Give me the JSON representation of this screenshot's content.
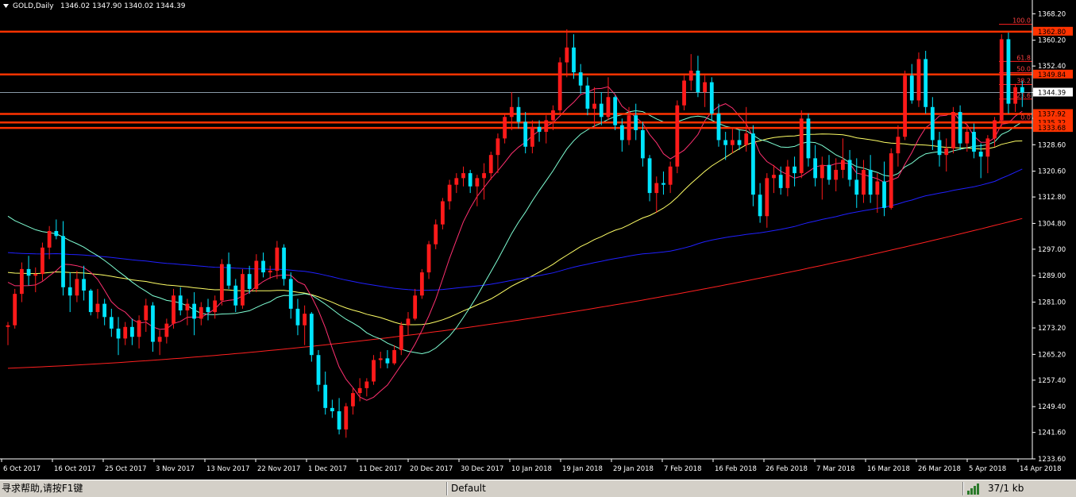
{
  "header": {
    "symbol": "GOLD,Daily",
    "ohlc": "1346.02 1347.90 1340.02 1344.39"
  },
  "chart_data": {
    "type": "candlestick",
    "symbol": "GOLD",
    "timeframe": "Daily",
    "ylim": [
      1233.6,
      1369.0
    ],
    "y_ticks": [
      "1368.20",
      "1360.20",
      "1352.40",
      "1344.39",
      "1336.60",
      "1328.60",
      "1320.60",
      "1312.80",
      "1304.80",
      "1297.00",
      "1289.00",
      "1281.00",
      "1273.20",
      "1265.20",
      "1257.40",
      "1249.40",
      "1241.60",
      "1233.60"
    ],
    "x_ticks": [
      "6 Oct 2017",
      "16 Oct 2017",
      "25 Oct 2017",
      "3 Nov 2017",
      "13 Nov 2017",
      "22 Nov 2017",
      "1 Dec 2017",
      "11 Dec 2017",
      "20 Dec 2017",
      "30 Dec 2017",
      "10 Jan 2018",
      "19 Jan 2018",
      "29 Jan 2018",
      "7 Feb 2018",
      "16 Feb 2018",
      "26 Feb 2018",
      "7 Mar 2018",
      "16 Mar 2018",
      "26 Mar 2018",
      "5 Apr 2018",
      "14 Apr 2018"
    ],
    "current_price": 1344.39,
    "horizontal_levels": [
      {
        "value": 1362.8,
        "label": "1362.80"
      },
      {
        "value": 1349.84,
        "label": "1349.84"
      },
      {
        "value": 1337.92,
        "label": "1337.92"
      },
      {
        "value": 1335.32,
        "label": "1335.32"
      },
      {
        "value": 1333.68,
        "label": "1333.68"
      }
    ],
    "fibonacci": [
      {
        "label": "100.0",
        "value": 1365.0
      },
      {
        "label": "61.8",
        "value": 1353.8
      },
      {
        "label": "50.0",
        "value": 1350.4
      },
      {
        "label": "38.2",
        "value": 1346.8
      },
      {
        "label": "23.6",
        "value": 1342.4
      },
      {
        "label": "0.0",
        "value": 1335.8
      }
    ],
    "candles": [
      [
        1273.5,
        1275.0,
        1268.0,
        1274.0
      ],
      [
        1274.0,
        1285.0,
        1273.0,
        1283.5
      ],
      [
        1283.5,
        1293.0,
        1281.0,
        1291.0
      ],
      [
        1291.0,
        1295.0,
        1286.0,
        1289.0
      ],
      [
        1289.0,
        1291.5,
        1284.0,
        1289.5
      ],
      [
        1289.5,
        1299.0,
        1287.5,
        1297.5
      ],
      [
        1297.5,
        1304.0,
        1294.0,
        1302.5
      ],
      [
        1302.5,
        1306.0,
        1300.0,
        1301.0
      ],
      [
        1301.0,
        1305.5,
        1283.0,
        1285.5
      ],
      [
        1285.5,
        1290.0,
        1278.0,
        1283.0
      ],
      [
        1283.0,
        1290.5,
        1281.0,
        1288.0
      ],
      [
        1288.0,
        1292.0,
        1281.5,
        1284.5
      ],
      [
        1284.5,
        1285.0,
        1277.0,
        1278.0
      ],
      [
        1278.0,
        1285.0,
        1276.0,
        1280.5
      ],
      [
        1280.5,
        1282.0,
        1274.0,
        1276.5
      ],
      [
        1276.5,
        1279.0,
        1270.5,
        1273.0
      ],
      [
        1273.0,
        1276.5,
        1265.0,
        1270.0
      ],
      [
        1270.0,
        1275.0,
        1268.0,
        1273.5
      ],
      [
        1273.5,
        1276.0,
        1268.0,
        1270.5
      ],
      [
        1270.5,
        1277.0,
        1267.0,
        1275.5
      ],
      [
        1275.5,
        1282.0,
        1272.0,
        1280.0
      ],
      [
        1280.0,
        1281.0,
        1266.0,
        1269.0
      ],
      [
        1269.0,
        1272.5,
        1265.0,
        1270.5
      ],
      [
        1270.5,
        1276.0,
        1268.5,
        1274.5
      ],
      [
        1274.5,
        1285.0,
        1273.0,
        1283.0
      ],
      [
        1283.0,
        1285.5,
        1277.0,
        1278.5
      ],
      [
        1278.5,
        1282.0,
        1274.0,
        1280.5
      ],
      [
        1280.5,
        1284.0,
        1271.0,
        1276.0
      ],
      [
        1276.0,
        1281.0,
        1274.0,
        1279.5
      ],
      [
        1279.5,
        1282.0,
        1275.5,
        1278.0
      ],
      [
        1278.0,
        1283.0,
        1276.0,
        1281.5
      ],
      [
        1281.5,
        1294.0,
        1280.0,
        1292.5
      ],
      [
        1292.5,
        1296.0,
        1285.0,
        1286.0
      ],
      [
        1286.0,
        1288.0,
        1278.0,
        1280.0
      ],
      [
        1280.0,
        1291.0,
        1279.0,
        1289.5
      ],
      [
        1289.5,
        1292.0,
        1283.5,
        1285.0
      ],
      [
        1285.0,
        1295.5,
        1284.0,
        1293.5
      ],
      [
        1293.5,
        1296.0,
        1288.5,
        1290.0
      ],
      [
        1290.0,
        1292.0,
        1288.0,
        1290.5
      ],
      [
        1290.5,
        1299.5,
        1288.0,
        1297.5
      ],
      [
        1297.5,
        1298.5,
        1286.0,
        1288.0
      ],
      [
        1288.0,
        1290.0,
        1276.0,
        1279.0
      ],
      [
        1279.0,
        1282.0,
        1271.0,
        1274.0
      ],
      [
        1274.0,
        1280.0,
        1268.0,
        1277.5
      ],
      [
        1277.5,
        1278.0,
        1263.0,
        1265.0
      ],
      [
        1265.0,
        1266.5,
        1254.0,
        1256.0
      ],
      [
        1256.0,
        1260.0,
        1247.0,
        1249.0
      ],
      [
        1249.0,
        1251.5,
        1246.0,
        1248.0
      ],
      [
        1248.0,
        1252.0,
        1241.0,
        1242.5
      ],
      [
        1242.5,
        1250.5,
        1240.0,
        1249.5
      ],
      [
        1249.5,
        1255.0,
        1247.0,
        1253.5
      ],
      [
        1253.5,
        1258.0,
        1251.0,
        1255.0
      ],
      [
        1255.0,
        1258.0,
        1252.5,
        1257.0
      ],
      [
        1257.0,
        1265.0,
        1256.0,
        1263.5
      ],
      [
        1263.5,
        1266.0,
        1261.0,
        1264.0
      ],
      [
        1264.0,
        1266.5,
        1261.0,
        1262.5
      ],
      [
        1262.5,
        1268.0,
        1262.0,
        1266.5
      ],
      [
        1266.5,
        1275.0,
        1265.0,
        1274.0
      ],
      [
        1274.0,
        1278.0,
        1271.0,
        1276.0
      ],
      [
        1276.0,
        1285.0,
        1275.5,
        1283.0
      ],
      [
        1283.0,
        1291.0,
        1282.0,
        1290.0
      ],
      [
        1290.0,
        1299.5,
        1288.0,
        1298.5
      ],
      [
        1298.5,
        1306.0,
        1297.0,
        1304.5
      ],
      [
        1304.5,
        1312.5,
        1303.0,
        1311.5
      ],
      [
        1311.5,
        1318.0,
        1309.0,
        1316.5
      ],
      [
        1316.5,
        1320.0,
        1314.0,
        1318.5
      ],
      [
        1318.5,
        1322.0,
        1316.0,
        1320.0
      ],
      [
        1320.0,
        1321.0,
        1314.0,
        1316.0
      ],
      [
        1316.0,
        1319.5,
        1310.0,
        1318.5
      ],
      [
        1318.5,
        1323.0,
        1312.0,
        1320.0
      ],
      [
        1320.0,
        1326.5,
        1318.0,
        1325.5
      ],
      [
        1325.5,
        1332.0,
        1320.0,
        1330.5
      ],
      [
        1330.5,
        1338.0,
        1329.0,
        1337.0
      ],
      [
        1337.0,
        1344.5,
        1333.0,
        1340.0
      ],
      [
        1340.0,
        1343.0,
        1333.5,
        1335.5
      ],
      [
        1335.5,
        1338.5,
        1326.0,
        1328.0
      ],
      [
        1328.0,
        1336.0,
        1326.0,
        1334.0
      ],
      [
        1334.0,
        1336.0,
        1329.5,
        1332.5
      ],
      [
        1332.5,
        1337.5,
        1329.0,
        1336.0
      ],
      [
        1336.0,
        1340.5,
        1333.0,
        1339.0
      ],
      [
        1339.0,
        1355.0,
        1338.0,
        1353.5
      ],
      [
        1353.5,
        1363.5,
        1349.0,
        1358.0
      ],
      [
        1358.0,
        1362.0,
        1348.5,
        1350.5
      ],
      [
        1350.5,
        1353.0,
        1344.0,
        1346.5
      ],
      [
        1346.5,
        1349.0,
        1337.5,
        1339.5
      ],
      [
        1339.5,
        1346.0,
        1333.5,
        1341.0
      ],
      [
        1341.0,
        1344.5,
        1334.5,
        1337.0
      ],
      [
        1337.0,
        1349.0,
        1336.0,
        1343.0
      ],
      [
        1343.0,
        1343.5,
        1333.0,
        1334.5
      ],
      [
        1334.5,
        1336.5,
        1326.5,
        1330.0
      ],
      [
        1330.0,
        1340.0,
        1328.5,
        1337.5
      ],
      [
        1337.5,
        1341.0,
        1330.0,
        1333.0
      ],
      [
        1333.0,
        1335.5,
        1322.0,
        1324.5
      ],
      [
        1324.5,
        1325.5,
        1311.5,
        1314.0
      ],
      [
        1314.0,
        1319.0,
        1308.0,
        1317.0
      ],
      [
        1317.0,
        1320.5,
        1313.5,
        1316.5
      ],
      [
        1316.5,
        1323.5,
        1314.0,
        1322.0
      ],
      [
        1322.0,
        1342.0,
        1320.0,
        1340.5
      ],
      [
        1340.5,
        1349.5,
        1339.0,
        1348.0
      ],
      [
        1348.0,
        1356.0,
        1345.0,
        1351.0
      ],
      [
        1351.0,
        1355.5,
        1343.0,
        1344.5
      ],
      [
        1344.5,
        1349.5,
        1340.0,
        1347.5
      ],
      [
        1347.5,
        1349.0,
        1336.0,
        1338.0
      ],
      [
        1338.0,
        1341.0,
        1328.0,
        1330.0
      ],
      [
        1330.0,
        1332.5,
        1324.0,
        1328.5
      ],
      [
        1328.5,
        1333.5,
        1326.0,
        1330.0
      ],
      [
        1330.0,
        1333.0,
        1327.0,
        1328.5
      ],
      [
        1328.5,
        1340.0,
        1326.5,
        1332.0
      ],
      [
        1332.0,
        1334.5,
        1310.0,
        1313.5
      ],
      [
        1313.5,
        1317.0,
        1305.0,
        1307.0
      ],
      [
        1307.0,
        1320.0,
        1303.5,
        1318.5
      ],
      [
        1318.5,
        1322.5,
        1314.0,
        1319.5
      ],
      [
        1319.5,
        1322.0,
        1313.5,
        1315.5
      ],
      [
        1315.5,
        1324.0,
        1313.0,
        1322.0
      ],
      [
        1322.0,
        1325.0,
        1316.0,
        1320.0
      ],
      [
        1320.0,
        1339.0,
        1318.5,
        1336.5
      ],
      [
        1336.5,
        1338.0,
        1322.0,
        1324.5
      ],
      [
        1324.5,
        1328.5,
        1316.0,
        1318.5
      ],
      [
        1318.5,
        1325.0,
        1312.0,
        1322.5
      ],
      [
        1322.5,
        1325.5,
        1316.5,
        1318.0
      ],
      [
        1318.0,
        1324.5,
        1314.5,
        1321.0
      ],
      [
        1321.0,
        1330.5,
        1318.5,
        1324.0
      ],
      [
        1324.0,
        1327.0,
        1316.0,
        1318.0
      ],
      [
        1318.0,
        1324.5,
        1309.5,
        1313.5
      ],
      [
        1313.5,
        1324.0,
        1311.0,
        1321.0
      ],
      [
        1321.0,
        1325.5,
        1311.0,
        1313.5
      ],
      [
        1313.5,
        1320.0,
        1308.0,
        1317.5
      ],
      [
        1317.5,
        1323.5,
        1307.0,
        1309.5
      ],
      [
        1309.5,
        1327.5,
        1309.0,
        1326.0
      ],
      [
        1326.0,
        1334.5,
        1322.0,
        1331.0
      ],
      [
        1331.0,
        1351.0,
        1330.0,
        1349.5
      ],
      [
        1349.5,
        1353.0,
        1341.0,
        1342.0
      ],
      [
        1342.0,
        1356.5,
        1340.0,
        1354.5
      ],
      [
        1354.5,
        1357.0,
        1338.0,
        1340.0
      ],
      [
        1340.0,
        1343.0,
        1327.0,
        1330.0
      ],
      [
        1330.0,
        1332.5,
        1322.0,
        1325.5
      ],
      [
        1325.5,
        1330.5,
        1320.5,
        1327.5
      ],
      [
        1327.5,
        1340.0,
        1326.0,
        1338.5
      ],
      [
        1338.5,
        1340.5,
        1327.0,
        1329.0
      ],
      [
        1329.0,
        1334.5,
        1326.5,
        1332.5
      ],
      [
        1332.5,
        1335.0,
        1324.5,
        1326.5
      ],
      [
        1326.5,
        1329.0,
        1318.5,
        1325.0
      ],
      [
        1325.0,
        1331.5,
        1320.0,
        1330.5
      ],
      [
        1330.5,
        1337.0,
        1328.0,
        1336.0
      ],
      [
        1336.0,
        1362.0,
        1334.0,
        1360.5
      ],
      [
        1360.5,
        1362.5,
        1338.0,
        1341.0
      ],
      [
        1341.0,
        1347.0,
        1338.5,
        1346.0
      ],
      [
        1346.02,
        1347.9,
        1340.02,
        1344.39
      ]
    ],
    "moving_averages": [
      {
        "color": "#ff2020",
        "values": [
          1261,
          1273.3
        ]
      },
      {
        "color": "#ffff66",
        "values": [
          1290,
          1331
        ]
      },
      {
        "color": "#2020ff",
        "values": [
          1296,
          1330
        ]
      },
      {
        "color": "#7fffd4",
        "values": [
          1307,
          1331
        ]
      },
      {
        "color": "#ff3070",
        "values": [
          1287,
          1333
        ]
      }
    ]
  },
  "status_bar": {
    "help_text": "寻求帮助,请按F1键",
    "profile": "Default",
    "connection": "37/1 kb"
  },
  "colors": {
    "background": "#000000",
    "bull": "#ff1a1a",
    "bear": "#00e5ff",
    "level_line": "#ff3300",
    "axis_text": "#ffffff"
  }
}
